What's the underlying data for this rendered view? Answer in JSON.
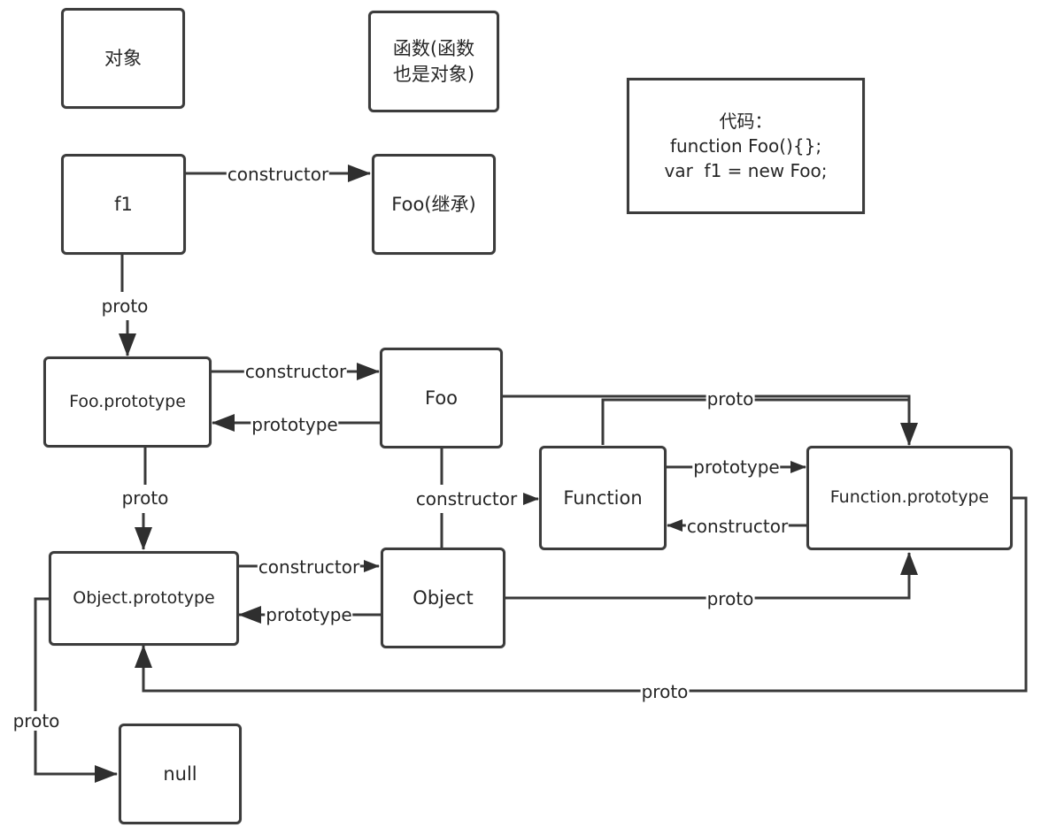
{
  "legend": {
    "object_label": "对象",
    "function_label_line1": "函数(函数",
    "function_label_line2": "也是对象)"
  },
  "code_box": {
    "title": "代码：",
    "line1": "function Foo(){};",
    "line2": "var  f1 = new Foo;"
  },
  "nodes": {
    "f1": "f1",
    "foo_inherit": "Foo(继承)",
    "foo_prototype": "Foo.prototype",
    "foo": "Foo",
    "function": "Function",
    "function_prototype": "Function.prototype",
    "object_prototype": "Object.prototype",
    "object": "Object",
    "null": "null"
  },
  "edges": [
    {
      "from": "f1",
      "to": "foo_inherit",
      "label": "constructor"
    },
    {
      "from": "f1",
      "to": "foo_prototype",
      "label": "proto"
    },
    {
      "from": "foo_prototype",
      "to": "foo",
      "label": "constructor"
    },
    {
      "from": "foo",
      "to": "foo_prototype",
      "label": "prototype"
    },
    {
      "from": "foo",
      "to": "function_prototype",
      "label": "proto"
    },
    {
      "from": "function",
      "to": "function_prototype",
      "label": "proto"
    },
    {
      "from": "foo_prototype",
      "to": "object_prototype",
      "label": "proto"
    },
    {
      "from": "object",
      "to": "function",
      "label": "constructor"
    },
    {
      "from": "foo",
      "to": "function",
      "label": "constructor"
    },
    {
      "from": "function",
      "to": "function_prototype",
      "label": "prototype"
    },
    {
      "from": "function_prototype",
      "to": "function",
      "label": "constructor"
    },
    {
      "from": "object_prototype",
      "to": "object",
      "label": "constructor"
    },
    {
      "from": "object",
      "to": "object_prototype",
      "label": "prototype"
    },
    {
      "from": "object",
      "to": "function_prototype",
      "label": "proto"
    },
    {
      "from": "function_prototype",
      "to": "object_prototype",
      "label": "proto"
    },
    {
      "from": "object_prototype",
      "to": "null",
      "label": "proto"
    }
  ],
  "edge_labels": {
    "f1_constructor": "constructor",
    "f1_proto": "proto",
    "fooproto_constructor": "constructor",
    "foo_prototype": "prototype",
    "foo_proto": "proto",
    "fooproto_proto": "proto",
    "foo_object_constructor": "constructor",
    "function_prototype": "prototype",
    "funcproto_constructor": "constructor",
    "objproto_constructor": "constructor",
    "object_prototype": "prototype",
    "object_proto": "proto",
    "funcproto_proto": "proto",
    "objproto_proto": "proto"
  }
}
